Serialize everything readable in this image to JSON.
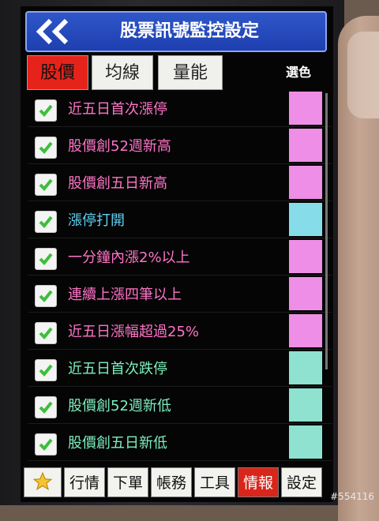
{
  "header": {
    "back_icon": "double-chevron-left-icon",
    "back_glyph": "《",
    "title": "股票訊號監控設定"
  },
  "tabs": [
    {
      "label": "股價",
      "active": true
    },
    {
      "label": "均線",
      "active": false
    },
    {
      "label": "量能",
      "active": false
    }
  ],
  "color_pick_label": "選色",
  "signals": [
    {
      "label": "近五日首次漲停",
      "checked": true,
      "text_color": "#ff74c8",
      "swatch_color": "#ef8ee6"
    },
    {
      "label": "股價創52週新高",
      "checked": true,
      "text_color": "#ff74c8",
      "swatch_color": "#ef8ee6"
    },
    {
      "label": "股價創五日新高",
      "checked": true,
      "text_color": "#ff74c8",
      "swatch_color": "#ef8ee6"
    },
    {
      "label": "漲停打開",
      "checked": true,
      "text_color": "#5fd0f2",
      "swatch_color": "#86dde9"
    },
    {
      "label": "一分鐘內漲2%以上",
      "checked": true,
      "text_color": "#ff74c8",
      "swatch_color": "#ef8ee6"
    },
    {
      "label": "連續上漲四筆以上",
      "checked": true,
      "text_color": "#ff74c8",
      "swatch_color": "#ef8ee6"
    },
    {
      "label": "近五日漲幅超過25%",
      "checked": true,
      "text_color": "#ff74c8",
      "swatch_color": "#ef8ee6"
    },
    {
      "label": "近五日首次跌停",
      "checked": true,
      "text_color": "#7ef0c0",
      "swatch_color": "#8ee2cf"
    },
    {
      "label": "股價創52週新低",
      "checked": true,
      "text_color": "#7ef0c0",
      "swatch_color": "#8ee2cf"
    },
    {
      "label": "股價創五日新低",
      "checked": true,
      "text_color": "#7ef0c0",
      "swatch_color": "#8ee2cf"
    }
  ],
  "bottom_nav": [
    {
      "label": "",
      "icon": "star-icon",
      "active": false
    },
    {
      "label": "行情",
      "active": false
    },
    {
      "label": "下單",
      "active": false
    },
    {
      "label": "帳務",
      "active": false
    },
    {
      "label": "工具",
      "active": false
    },
    {
      "label": "情報",
      "active": true
    },
    {
      "label": "設定",
      "active": false
    }
  ],
  "watermark": "#554116",
  "colors": {
    "header_blue": "#1e3fb0",
    "active_red": "#e6231a",
    "check_green": "#3cbf3c"
  }
}
